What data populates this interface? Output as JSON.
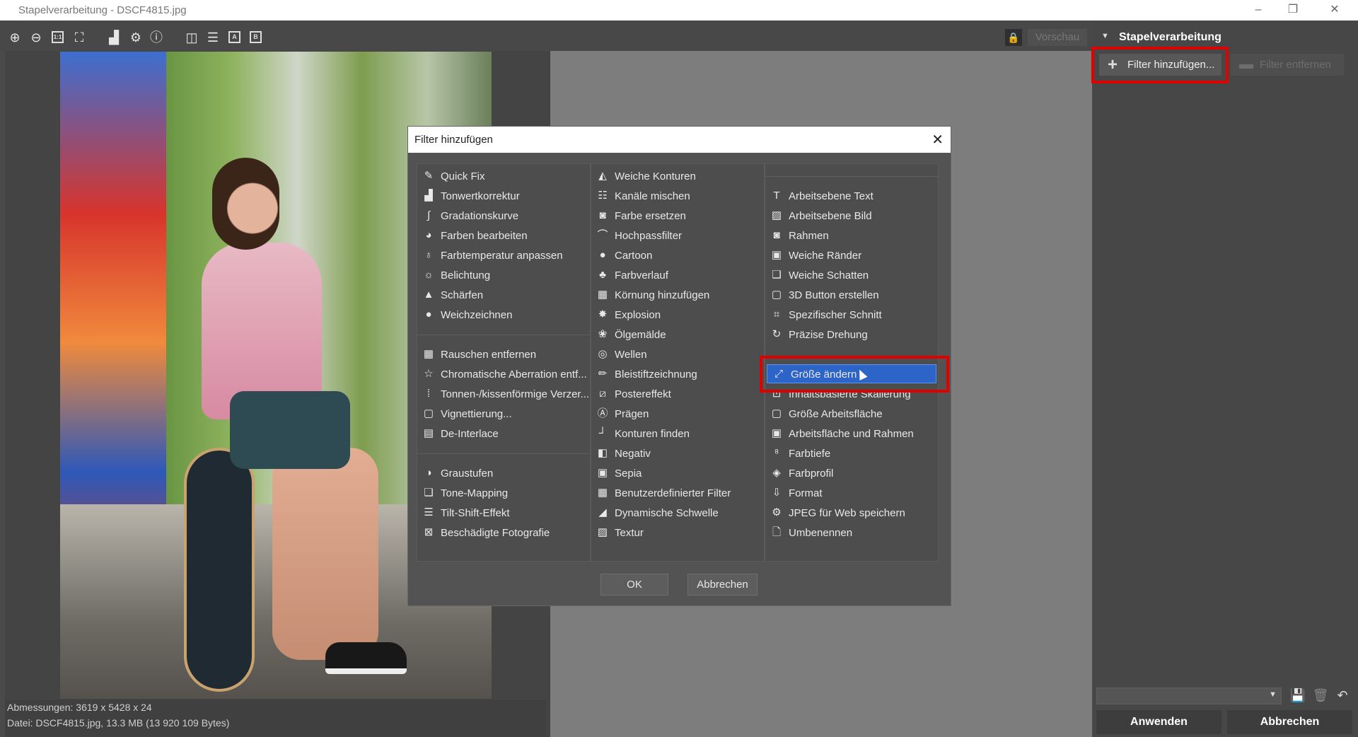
{
  "window": {
    "title": "Stapelverarbeitung - DSCF4815.jpg"
  },
  "toolbar": {
    "preview_label": "Vorschau",
    "box_a": "A",
    "box_b": "B",
    "one_to_one": "1:1"
  },
  "sidebar": {
    "header": "Stapelverarbeitung",
    "add_filter_label": "Filter hinzufügen...",
    "remove_filter_label": "Filter entfernen",
    "apply_label": "Anwenden",
    "cancel_label": "Abbrechen"
  },
  "info": {
    "dimensions": "Abmessungen: 3619 x 5428 x 24",
    "file": "Datei: DSCF4815.jpg, 13.3 MB (13 920 109 Bytes)"
  },
  "dialog": {
    "title": "Filter hinzufügen",
    "ok_label": "OK",
    "cancel_label": "Abbrechen",
    "col1": {
      "g1": [
        "Quick Fix",
        "Tonwertkorrektur",
        "Gradationskurve",
        "Farben bearbeiten",
        "Farbtemperatur anpassen",
        "Belichtung",
        "Schärfen",
        "Weichzeichnen"
      ],
      "g2": [
        "Rauschen entfernen",
        "Chromatische Aberration entf...",
        "Tonnen-/kissenförmige Verzer...",
        "Vignettierung...",
        "De-Interlace"
      ],
      "g3": [
        "Graustufen",
        "Tone-Mapping",
        "Tilt-Shift-Effekt",
        "Beschädigte Fotografie"
      ]
    },
    "col2": [
      "Weiche Konturen",
      "Kanäle mischen",
      "Farbe ersetzen",
      "Hochpassfilter",
      "Cartoon",
      "Farbverlauf",
      "Körnung hinzufügen",
      "Explosion",
      "Ölgemälde",
      "Wellen",
      "Bleistiftzeichnung",
      "Postereffekt",
      "Prägen",
      "Konturen finden",
      "Negativ",
      "Sepia",
      "Benutzerdefinierter Filter",
      "Dynamische Schwelle",
      "Textur"
    ],
    "col3": {
      "g1": [
        "Arbeitsebene Text",
        "Arbeitsebene Bild",
        "Rahmen",
        "Weiche Ränder",
        "Weiche Schatten",
        "3D Button erstellen",
        "Spezifischer Schnitt",
        "Präzise Drehung"
      ],
      "g2": [
        "Größe ändern",
        "Inhaltsbasierte Skalierung",
        "Größe Arbeitsfläche",
        "Arbeitsfläche und Rahmen",
        "Farbtiefe",
        "Farbprofil",
        "Format",
        "JPEG für Web speichern",
        "Umbenennen"
      ],
      "selected": "Größe ändern"
    }
  }
}
